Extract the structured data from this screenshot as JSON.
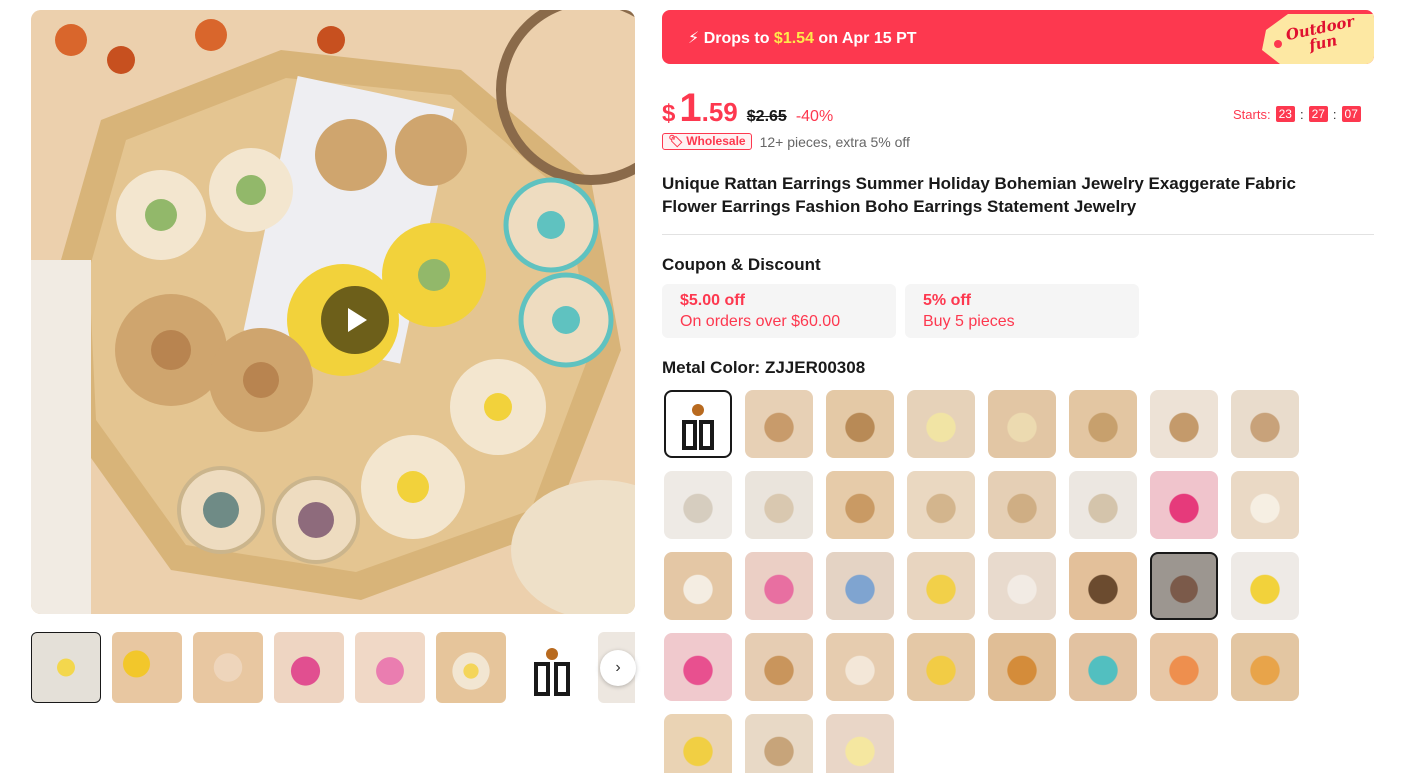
{
  "promo": {
    "prefix": "Drops to",
    "price": "$1.54",
    "suffix": "on Apr 15 PT",
    "tag_line1": "Outdoor",
    "tag_line2": "fun"
  },
  "price": {
    "currency": "$",
    "integer": "1",
    "decimal": ".59",
    "original": "$2.65",
    "discount": "-40%"
  },
  "countdown": {
    "label": "Starts:",
    "hours": "23",
    "minutes": "27",
    "seconds": "07"
  },
  "wholesale": {
    "badge": "Wholesale",
    "text": "12+ pieces, extra 5% off"
  },
  "product": {
    "title": "Unique Rattan Earrings Summer Holiday Bohemian Jewelry Exaggerate Fabric Flower Earrings Fashion Boho Earrings Statement Jewelry"
  },
  "coupons": {
    "heading": "Coupon & Discount",
    "items": [
      {
        "title": "$5.00 off",
        "subtitle": "On orders over $60.00"
      },
      {
        "title": "5% off",
        "subtitle": "Buy 5 pieces"
      }
    ]
  },
  "variant": {
    "label": "Metal Color:",
    "value": "ZJJER00308",
    "selected_index": 0,
    "hover_index": 22,
    "count": 35
  },
  "gallery": {
    "thumbnail_count": 8,
    "active_thumbnail": 0
  },
  "colors": {
    "accent": "#fd384f",
    "highlight": "#ffe94b",
    "text": "#191919"
  },
  "icons": {
    "promo": "lightning-icon",
    "play": "play-icon",
    "next": "chevron-right-icon",
    "wholesale": "tag-icon"
  }
}
